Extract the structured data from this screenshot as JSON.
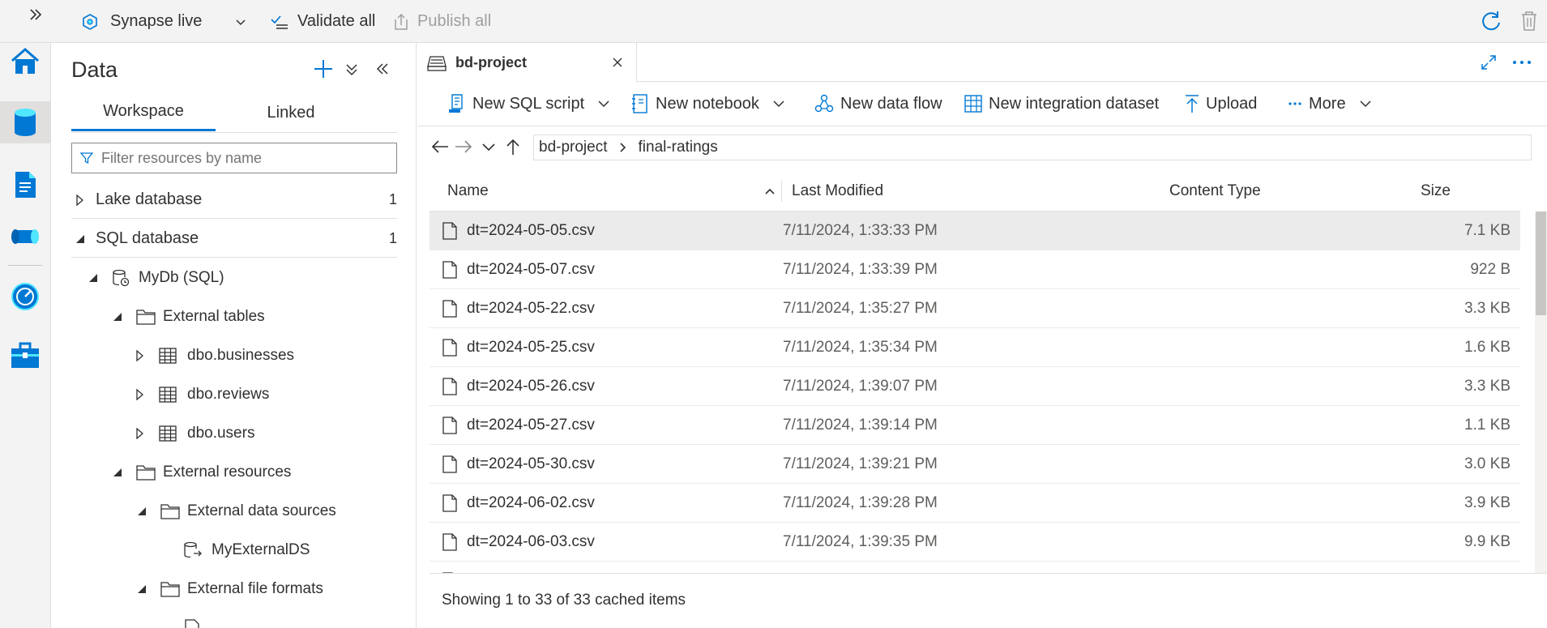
{
  "topbar": {
    "expand_icon": "double-chevron-right-icon",
    "workspace_mode": "Synapse live",
    "validate_label": "Validate all",
    "publish_label": "Publish all"
  },
  "rail": {
    "items": [
      {
        "name": "home",
        "icon": "home-icon",
        "active": false
      },
      {
        "name": "data",
        "icon": "database-icon",
        "active": true
      },
      {
        "name": "develop",
        "icon": "document-icon",
        "active": false
      },
      {
        "name": "integrate",
        "icon": "pipeline-icon",
        "active": false
      },
      {
        "name": "monitor",
        "icon": "monitor-gauge-icon",
        "active": false
      },
      {
        "name": "manage",
        "icon": "toolbox-icon",
        "active": false
      }
    ]
  },
  "data_panel": {
    "title": "Data",
    "tabs": [
      {
        "label": "Workspace",
        "active": true
      },
      {
        "label": "Linked",
        "active": false
      }
    ],
    "filter_placeholder": "Filter resources by name",
    "tree": [
      {
        "label": "Lake database",
        "count": "1",
        "expanded": false,
        "level": 0,
        "icon": ""
      },
      {
        "label": "SQL database",
        "count": "1",
        "expanded": true,
        "level": 0,
        "icon": ""
      },
      {
        "label": "MyDb (SQL)",
        "count": "",
        "expanded": true,
        "level": 1,
        "icon": "database-icon"
      },
      {
        "label": "External tables",
        "count": "",
        "expanded": true,
        "level": 2,
        "icon": "folder-icon"
      },
      {
        "label": "dbo.businesses",
        "count": "",
        "expanded": false,
        "level": 3,
        "icon": "table-icon"
      },
      {
        "label": "dbo.reviews",
        "count": "",
        "expanded": false,
        "level": 3,
        "icon": "table-icon"
      },
      {
        "label": "dbo.users",
        "count": "",
        "expanded": false,
        "level": 3,
        "icon": "table-icon"
      },
      {
        "label": "External resources",
        "count": "",
        "expanded": true,
        "level": 2,
        "icon": "folder-icon"
      },
      {
        "label": "External data sources",
        "count": "",
        "expanded": true,
        "level": 3,
        "icon": "folder-icon"
      },
      {
        "label": "MyExternalDS",
        "count": "",
        "expanded": null,
        "level": 4,
        "icon": "datasource-icon"
      },
      {
        "label": "External file formats",
        "count": "",
        "expanded": true,
        "level": 3,
        "icon": "folder-icon"
      }
    ]
  },
  "tab": {
    "label": "bd-project"
  },
  "command_bar": {
    "new_sql_script": "New SQL script",
    "new_notebook": "New notebook",
    "new_data_flow": "New data flow",
    "new_integration_dataset": "New integration dataset",
    "upload": "Upload",
    "more": "More"
  },
  "breadcrumb": {
    "items": [
      "bd-project",
      "final-ratings"
    ]
  },
  "table": {
    "columns": [
      "Name",
      "Last Modified",
      "Content Type",
      "Size"
    ],
    "sort_column": "Name",
    "rows": [
      {
        "name": "dt=2024-05-05.csv",
        "modified": "7/11/2024, 1:33:33 PM",
        "content_type": "",
        "size": "7.1 KB",
        "selected": true
      },
      {
        "name": "dt=2024-05-07.csv",
        "modified": "7/11/2024, 1:33:39 PM",
        "content_type": "",
        "size": "922 B",
        "selected": false
      },
      {
        "name": "dt=2024-05-22.csv",
        "modified": "7/11/2024, 1:35:27 PM",
        "content_type": "",
        "size": "3.3 KB",
        "selected": false
      },
      {
        "name": "dt=2024-05-25.csv",
        "modified": "7/11/2024, 1:35:34 PM",
        "content_type": "",
        "size": "1.6 KB",
        "selected": false
      },
      {
        "name": "dt=2024-05-26.csv",
        "modified": "7/11/2024, 1:39:07 PM",
        "content_type": "",
        "size": "3.3 KB",
        "selected": false
      },
      {
        "name": "dt=2024-05-27.csv",
        "modified": "7/11/2024, 1:39:14 PM",
        "content_type": "",
        "size": "1.1 KB",
        "selected": false
      },
      {
        "name": "dt=2024-05-30.csv",
        "modified": "7/11/2024, 1:39:21 PM",
        "content_type": "",
        "size": "3.0 KB",
        "selected": false
      },
      {
        "name": "dt=2024-06-02.csv",
        "modified": "7/11/2024, 1:39:28 PM",
        "content_type": "",
        "size": "3.9 KB",
        "selected": false
      },
      {
        "name": "dt=2024-06-03.csv",
        "modified": "7/11/2024, 1:39:35 PM",
        "content_type": "",
        "size": "9.9 KB",
        "selected": false
      }
    ]
  },
  "status_text": "Showing 1 to 33 of 33 cached items",
  "colors": {
    "accent": "#0078d4",
    "selected_row": "#ebebeb",
    "rail_bg": "#f3f3f3"
  }
}
